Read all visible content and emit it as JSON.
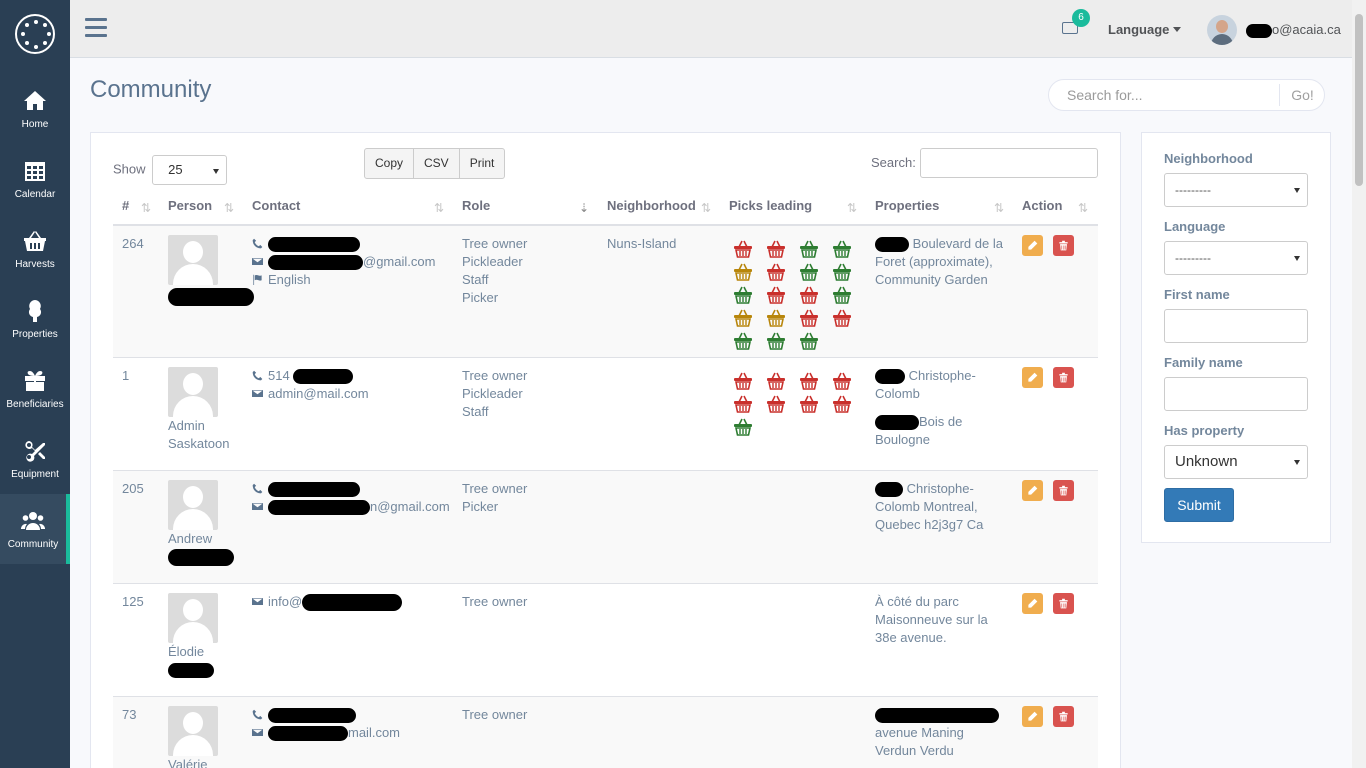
{
  "sidebar": {
    "items": [
      {
        "label": "Home",
        "icon": "home-icon"
      },
      {
        "label": "Calendar",
        "icon": "calendar-icon"
      },
      {
        "label": "Harvests",
        "icon": "basket-icon"
      },
      {
        "label": "Properties",
        "icon": "tree-icon"
      },
      {
        "label": "Beneficiaries",
        "icon": "gift-icon"
      },
      {
        "label": "Equipment",
        "icon": "scissors-icon"
      },
      {
        "label": "Community",
        "icon": "users-icon"
      }
    ],
    "active": "Community"
  },
  "topbar": {
    "mail_count": "6",
    "language_label": "Language",
    "user_email_suffix": "o@acaia.ca"
  },
  "page": {
    "title": "Community",
    "search_placeholder": "Search for...",
    "go_label": "Go!"
  },
  "table": {
    "show_label": "Show",
    "page_size": "25",
    "buttons": [
      "Copy",
      "CSV",
      "Print"
    ],
    "search_label": "Search:",
    "columns": [
      "#",
      "Person",
      "Contact",
      "Role",
      "Neighborhood",
      "Picks leading",
      "Properties",
      "Action"
    ],
    "rows": [
      {
        "id": "264",
        "name1": "",
        "name2": "",
        "phone": "",
        "email": "@gmail.com",
        "lang": "English",
        "roles": [
          "Tree owner",
          "Pickleader",
          "Staff",
          "Picker"
        ],
        "neighborhood": "Nuns-Island",
        "baskets": [
          "r",
          "r",
          "g",
          "g",
          "o",
          "r",
          "g",
          "g",
          "g",
          "r",
          "r",
          "g",
          "o",
          "o",
          "r",
          "r",
          "g",
          "g",
          "g"
        ],
        "properties": [
          "Boulevard de la Foret (approximate), Community Garden"
        ]
      },
      {
        "id": "1",
        "name1": "Admin",
        "name2": "Saskatoon",
        "phone": "514",
        "email": "admin@mail.com",
        "lang": "",
        "roles": [
          "Tree owner",
          "Pickleader",
          "Staff"
        ],
        "neighborhood": "",
        "baskets": [
          "r",
          "r",
          "r",
          "r",
          "r",
          "r",
          "r",
          "r",
          "g"
        ],
        "properties": [
          "Christophe-Colomb",
          "Bois de Boulogne"
        ]
      },
      {
        "id": "205",
        "name1": "Andrew",
        "name2": "",
        "phone": "",
        "email": "n@gmail.com",
        "lang": "",
        "roles": [
          "Tree owner",
          "Picker"
        ],
        "neighborhood": "",
        "baskets": [],
        "properties": [
          "Christophe-Colomb Montreal, Quebec h2j3g7 Ca"
        ]
      },
      {
        "id": "125",
        "name1": "Élodie",
        "name2": "",
        "phone": "",
        "email": "info@",
        "lang": "",
        "roles": [
          "Tree owner"
        ],
        "neighborhood": "",
        "baskets": [],
        "properties": [
          "À côté du parc Maisonneuve sur la 38e avenue."
        ]
      },
      {
        "id": "73",
        "name1": "Valérie",
        "name2": "",
        "phone": "",
        "email": "mail.com",
        "lang": "",
        "roles": [
          "Tree owner"
        ],
        "neighborhood": "",
        "baskets": [],
        "properties": [
          "avenue Maning Verdun Verdu"
        ]
      }
    ]
  },
  "filters": {
    "neighborhood_label": "Neighborhood",
    "neighborhood_value": "---------",
    "language_label": "Language",
    "language_value": "---------",
    "first_name_label": "First name",
    "family_name_label": "Family name",
    "has_property_label": "Has property",
    "has_property_value": "Unknown",
    "submit_label": "Submit"
  },
  "colors": {
    "sidebar": "#2a3f54",
    "accent": "#1abb9c",
    "basket_red": "#c9302c",
    "basket_green": "#2e7d32",
    "basket_orange": "#b8860b"
  }
}
